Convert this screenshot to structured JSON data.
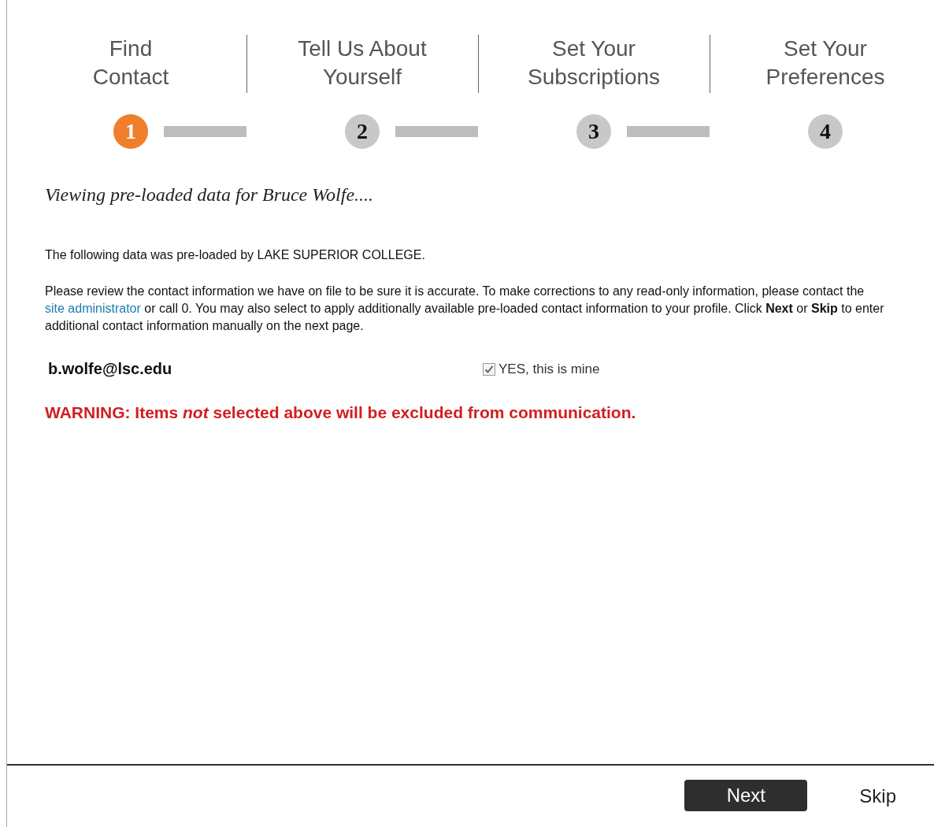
{
  "steps": [
    {
      "label": "Find\nContact",
      "number": "1",
      "selected": true
    },
    {
      "label": "Tell Us About\nYourself",
      "number": "2",
      "selected": false
    },
    {
      "label": "Set Your\nSubscriptions",
      "number": "3",
      "selected": false
    },
    {
      "label": "Set Your\nPreferences",
      "number": "4",
      "selected": false
    }
  ],
  "heading": "Viewing pre-loaded data for Bruce Wolfe....",
  "intro": "The following data was pre-loaded by LAKE SUPERIOR COLLEGE.",
  "instructions": {
    "before": "Please review the contact information we have on file to be sure it is accurate. To make corrections to any read-only information, please contact the",
    "link": "site administrator",
    "after": "or call 0. You may also select to apply additionally available pre-loaded contact information to your profile. Click **Next** or **Skip** to enter additional contact information manually on the next page."
  },
  "contacts": [
    {
      "value": "b.wolfe@lsc.edu",
      "confirm_label": "YES, this is mine",
      "checked": true
    }
  ],
  "warning": "WARNING: Items *not* selected above will be excluded from communication.",
  "footer": {
    "next": "Next",
    "skip": "Skip"
  }
}
